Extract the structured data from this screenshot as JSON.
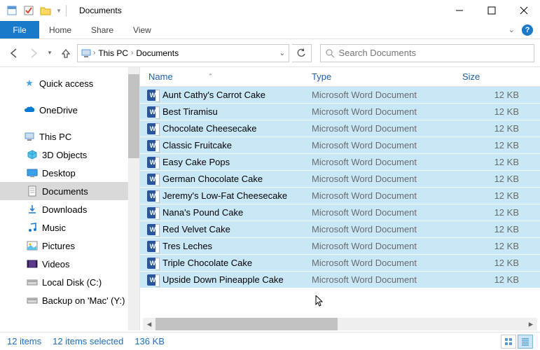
{
  "title": "Documents",
  "ribbon": {
    "file": "File",
    "tabs": [
      "Home",
      "Share",
      "View"
    ]
  },
  "breadcrumb": {
    "root": "This PC",
    "current": "Documents"
  },
  "search": {
    "placeholder": "Search Documents"
  },
  "tree": {
    "quick_access": "Quick access",
    "onedrive": "OneDrive",
    "this_pc": "This PC",
    "children": [
      "3D Objects",
      "Desktop",
      "Documents",
      "Downloads",
      "Music",
      "Pictures",
      "Videos",
      "Local Disk (C:)",
      "Backup on 'Mac' (Y:)"
    ]
  },
  "columns": {
    "name": "Name",
    "type": "Type",
    "size": "Size"
  },
  "files": [
    {
      "name": "Aunt Cathy's Carrot Cake",
      "type": "Microsoft Word Document",
      "size": "12 KB"
    },
    {
      "name": "Best Tiramisu",
      "type": "Microsoft Word Document",
      "size": "12 KB"
    },
    {
      "name": "Chocolate Cheesecake",
      "type": "Microsoft Word Document",
      "size": "12 KB"
    },
    {
      "name": "Classic Fruitcake",
      "type": "Microsoft Word Document",
      "size": "12 KB"
    },
    {
      "name": "Easy Cake Pops",
      "type": "Microsoft Word Document",
      "size": "12 KB"
    },
    {
      "name": "German Chocolate Cake",
      "type": "Microsoft Word Document",
      "size": "12 KB"
    },
    {
      "name": "Jeremy's Low-Fat Cheesecake",
      "type": "Microsoft Word Document",
      "size": "12 KB"
    },
    {
      "name": "Nana's Pound Cake",
      "type": "Microsoft Word Document",
      "size": "12 KB"
    },
    {
      "name": "Red Velvet Cake",
      "type": "Microsoft Word Document",
      "size": "12 KB"
    },
    {
      "name": "Tres Leches",
      "type": "Microsoft Word Document",
      "size": "12 KB"
    },
    {
      "name": "Triple Chocolate Cake",
      "type": "Microsoft Word Document",
      "size": "12 KB"
    },
    {
      "name": "Upside Down Pineapple Cake",
      "type": "Microsoft Word Document",
      "size": "12 KB"
    }
  ],
  "status": {
    "count": "12 items",
    "selected": "12 items selected",
    "size": "136 KB"
  }
}
